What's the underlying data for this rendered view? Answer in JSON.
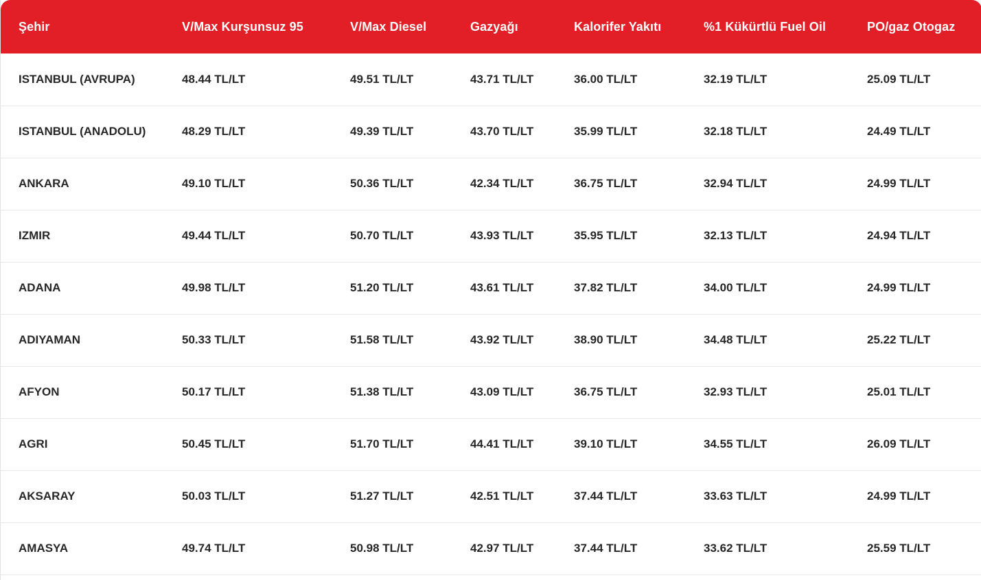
{
  "table": {
    "headers": [
      "Şehir",
      "V/Max Kurşunsuz 95",
      "V/Max Diesel",
      "Gazyağı",
      "Kalorifer Yakıtı",
      "%1 Kükürtlü Fuel Oil",
      "PO/gaz Otogaz"
    ],
    "rows": [
      [
        "ISTANBUL (AVRUPA)",
        "48.44 TL/LT",
        "49.51 TL/LT",
        "43.71 TL/LT",
        "36.00 TL/LT",
        "32.19 TL/LT",
        "25.09 TL/LT"
      ],
      [
        "ISTANBUL (ANADOLU)",
        "48.29 TL/LT",
        "49.39 TL/LT",
        "43.70 TL/LT",
        "35.99 TL/LT",
        "32.18 TL/LT",
        "24.49 TL/LT"
      ],
      [
        "ANKARA",
        "49.10 TL/LT",
        "50.36 TL/LT",
        "42.34 TL/LT",
        "36.75 TL/LT",
        "32.94 TL/LT",
        "24.99 TL/LT"
      ],
      [
        "IZMIR",
        "49.44 TL/LT",
        "50.70 TL/LT",
        "43.93 TL/LT",
        "35.95 TL/LT",
        "32.13 TL/LT",
        "24.94 TL/LT"
      ],
      [
        "ADANA",
        "49.98 TL/LT",
        "51.20 TL/LT",
        "43.61 TL/LT",
        "37.82 TL/LT",
        "34.00 TL/LT",
        "24.99 TL/LT"
      ],
      [
        "ADIYAMAN",
        "50.33 TL/LT",
        "51.58 TL/LT",
        "43.92 TL/LT",
        "38.90 TL/LT",
        "34.48 TL/LT",
        "25.22 TL/LT"
      ],
      [
        "AFYON",
        "50.17 TL/LT",
        "51.38 TL/LT",
        "43.09 TL/LT",
        "36.75 TL/LT",
        "32.93 TL/LT",
        "25.01 TL/LT"
      ],
      [
        "AGRI",
        "50.45 TL/LT",
        "51.70 TL/LT",
        "44.41 TL/LT",
        "39.10 TL/LT",
        "34.55 TL/LT",
        "26.09 TL/LT"
      ],
      [
        "AKSARAY",
        "50.03 TL/LT",
        "51.27 TL/LT",
        "42.51 TL/LT",
        "37.44 TL/LT",
        "33.63 TL/LT",
        "24.99 TL/LT"
      ],
      [
        "AMASYA",
        "49.74 TL/LT",
        "50.98 TL/LT",
        "42.97 TL/LT",
        "37.44 TL/LT",
        "33.62 TL/LT",
        "25.59 TL/LT"
      ]
    ]
  },
  "colors": {
    "header_bg": "#e21f26",
    "header_text": "#ffffff",
    "row_text": "#262626",
    "row_divider": "#e6e6e6"
  }
}
